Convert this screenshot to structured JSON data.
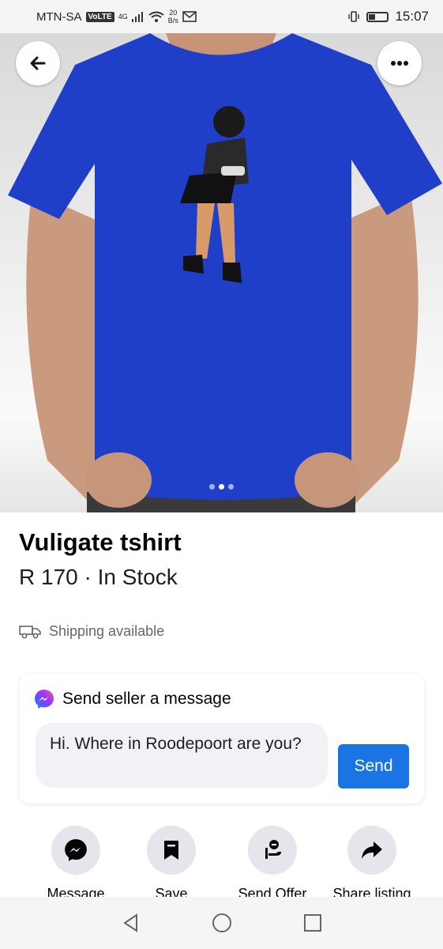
{
  "status_bar": {
    "carrier": "MTN-SA",
    "volte": "VoLTE",
    "network": "4G",
    "speed_value": "20",
    "speed_unit": "B/s",
    "time": "15:07"
  },
  "product": {
    "title": "Vuligate tshirt",
    "price_stock": "R 170 · In Stock",
    "shipping": "Shipping available",
    "image_count": 3,
    "active_image_index": 1,
    "shirt_color": "#1f3fc9"
  },
  "message_card": {
    "heading": "Send seller a message",
    "input_value": "Hi. Where in Roodepoort are you?",
    "send_label": "Send"
  },
  "actions": {
    "message_label": "Message",
    "save_label": "Save",
    "offer_label": "Send Offer",
    "share_label": "Share listing"
  },
  "colors": {
    "accent": "#1b74e4",
    "action_bg": "#e4e6eb",
    "input_bg": "#f0f2f5"
  }
}
